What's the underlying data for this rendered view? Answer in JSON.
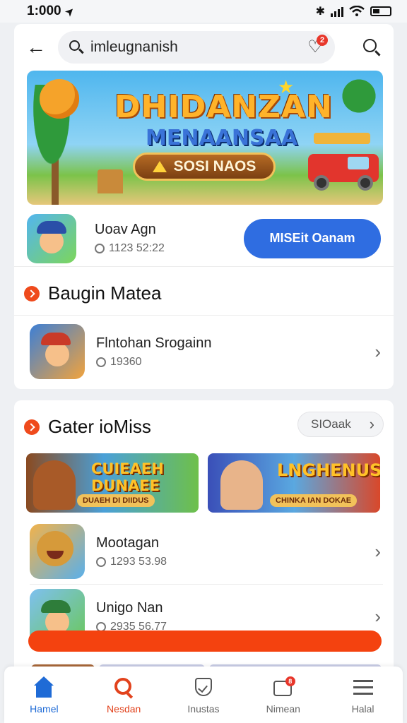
{
  "status_bar": {
    "time": "1:000",
    "nav_glyph": "➤",
    "bt_glyph": "✱"
  },
  "header": {
    "back_glyph": "←",
    "search_text": "imleugnanish",
    "heart_glyph": "♡",
    "heart_badge": "2"
  },
  "banner": {
    "title_line1": "DHIDANZAN",
    "title_line2": "MENAANSAA",
    "play_label": "SOSI NAOS"
  },
  "promo_app": {
    "name": "Uoav Agn",
    "meta": "1123 52:22",
    "button_label": "MISEit Oanam"
  },
  "section1": {
    "title": "Baugin Matea",
    "item": {
      "name": "Flntohan Srogainn",
      "meta": "19360"
    }
  },
  "section2": {
    "title": "Gater ioMiss",
    "more_label": "SIOaak",
    "mini_banners": [
      {
        "title": "CUIEAEH DUNAEE",
        "subtitle": "DUAEH DI DIIDUS"
      },
      {
        "title": "LNGHENUS",
        "subtitle": "CHINKA IAN DOKAE"
      }
    ],
    "items": [
      {
        "name": "Mootagan",
        "meta": "1293 53.98"
      },
      {
        "name": "Unigo Nan",
        "meta": "2935 56.77"
      }
    ]
  },
  "chevron_glyph": "›",
  "bottom_nav": {
    "items": [
      {
        "label": "Hamel",
        "icon": "home-icon"
      },
      {
        "label": "Nesdan",
        "icon": "search-icon"
      },
      {
        "label": "Inustas",
        "icon": "tag-icon"
      },
      {
        "label": "Nimean",
        "icon": "message-icon",
        "badge": "8"
      },
      {
        "label": "Halal",
        "icon": "menu-icon"
      }
    ]
  },
  "colors": {
    "accent_blue": "#2f6de1",
    "accent_orange": "#f4420f",
    "badge_red": "#e8372b"
  }
}
